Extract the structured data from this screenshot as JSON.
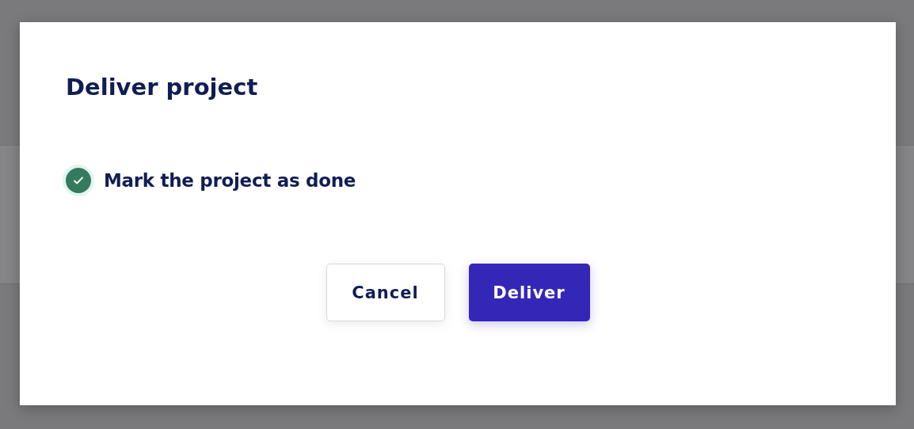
{
  "dialog": {
    "title": "Deliver project",
    "option": {
      "label": "Mark the project as done",
      "checked": true
    },
    "buttons": [
      {
        "label": "Cancel",
        "kind": "secondary"
      },
      {
        "label": "Deliver",
        "kind": "primary"
      }
    ]
  }
}
